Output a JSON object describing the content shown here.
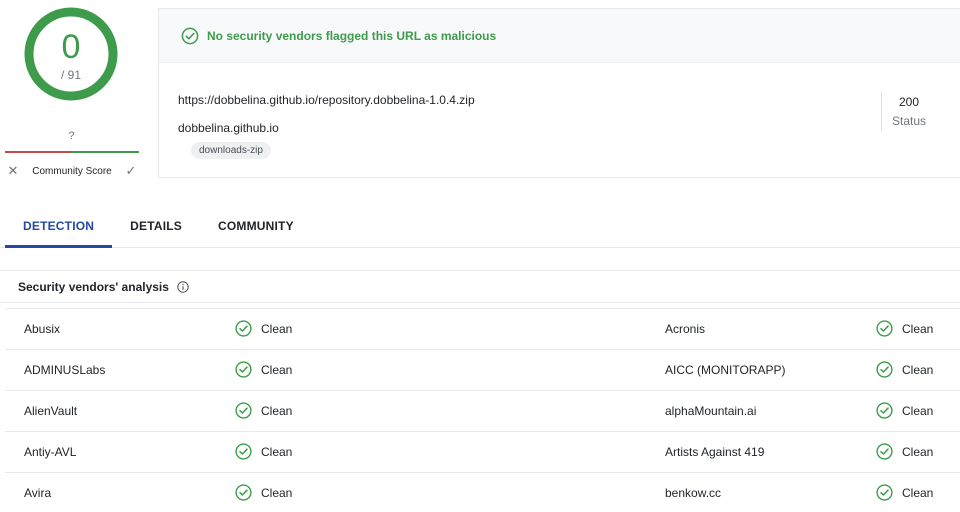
{
  "score": {
    "detections": "0",
    "total": "/ 91",
    "community_unknown": "?",
    "community_label": "Community Score"
  },
  "card": {
    "banner_message": "No security vendors flagged this URL as malicious",
    "url": "https://dobbelina.github.io/repository.dobbelina-1.0.4.zip",
    "domain": "dobbelina.github.io",
    "tag": "downloads-zip",
    "status_code": "200",
    "status_label": "Status"
  },
  "tabs": [
    {
      "label": "DETECTION",
      "active": true
    },
    {
      "label": "DETAILS",
      "active": false
    },
    {
      "label": "COMMUNITY",
      "active": false
    }
  ],
  "vendors_section": {
    "title": "Security vendors' analysis"
  },
  "vendors": [
    {
      "left": "Abusix",
      "left_result": "Clean",
      "right": "Acronis",
      "right_result": "Clean"
    },
    {
      "left": "ADMINUSLabs",
      "left_result": "Clean",
      "right": "AICC (MONITORAPP)",
      "right_result": "Clean"
    },
    {
      "left": "AlienVault",
      "left_result": "Clean",
      "right": "alphaMountain.ai",
      "right_result": "Clean"
    },
    {
      "left": "Antiy-AVL",
      "left_result": "Clean",
      "right": "Artists Against 419",
      "right_result": "Clean"
    },
    {
      "left": "Avira",
      "left_result": "Clean",
      "right": "benkow.cc",
      "right_result": "Clean"
    }
  ],
  "colors": {
    "clean_green": "#3e9b4b",
    "accent_blue": "#234aa0",
    "malicious_red": "#c44b4b"
  },
  "icons": {
    "gauge": "score-ring",
    "banner": "check-circle-icon",
    "vote_down": "close-icon",
    "vote_up": "checkmark-icon",
    "info": "info-circle-icon",
    "result": "check-circle-icon"
  }
}
